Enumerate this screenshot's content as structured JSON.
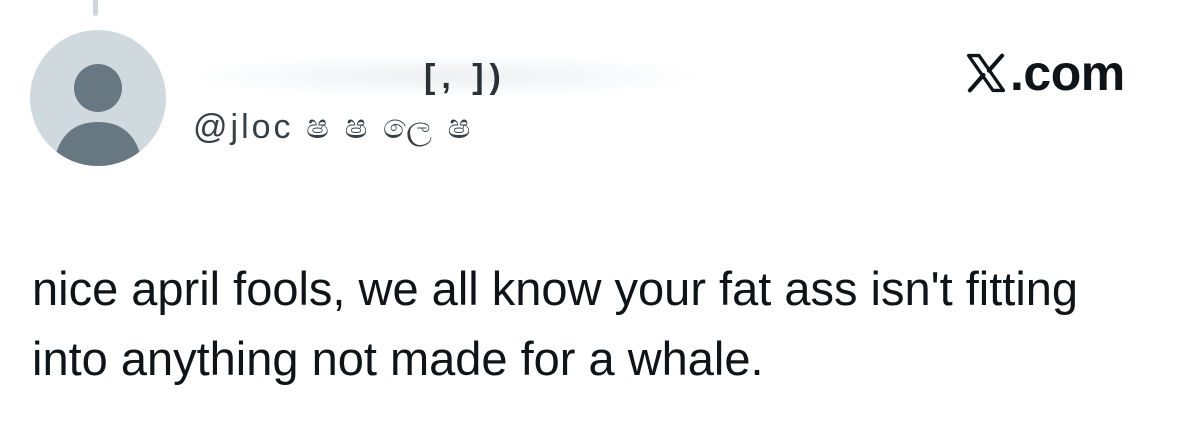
{
  "author": {
    "display_name": "[, ])",
    "handle": "@jloc ෂ ෂ ලෙ ෂ",
    "avatar_icon": "default-avatar-icon"
  },
  "brand": {
    "logo_icon": "x-logo-icon",
    "domain_suffix": ".com"
  },
  "tweet": {
    "text": "nice april fools, we all know your fat ass isn't fitting into anything not made for a whale."
  },
  "colors": {
    "background": "#ffffff",
    "text": "#0f1419",
    "avatar_bg": "#cfd9de",
    "avatar_figure": "#687883"
  }
}
